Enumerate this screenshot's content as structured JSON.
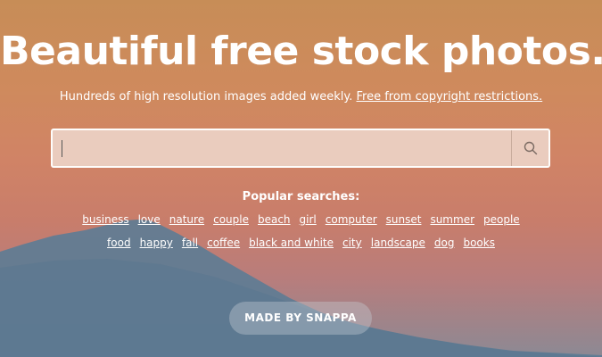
{
  "hero": {
    "title": "Beautiful free stock photos.",
    "subtitle_text": "Hundreds of high resolution images added weekly.",
    "subtitle_link": "Free from copyright restrictions."
  },
  "search": {
    "value": "",
    "placeholder": "",
    "button_icon": "search-icon"
  },
  "popular": {
    "heading": "Popular searches:",
    "row1": [
      "business",
      "love",
      "nature",
      "couple",
      "beach",
      "girl",
      "computer",
      "sunset",
      "summer",
      "people"
    ],
    "row2": [
      "food",
      "happy",
      "fall",
      "coffee",
      "black and white",
      "city",
      "landscape",
      "dog",
      "books"
    ]
  },
  "footer": {
    "made_by": "MADE BY SNAPPA"
  },
  "colors": {
    "sky_top": "#c78d57",
    "sky_mid": "#d08366",
    "mountain": "#5b7b93",
    "text": "#ffffff"
  }
}
